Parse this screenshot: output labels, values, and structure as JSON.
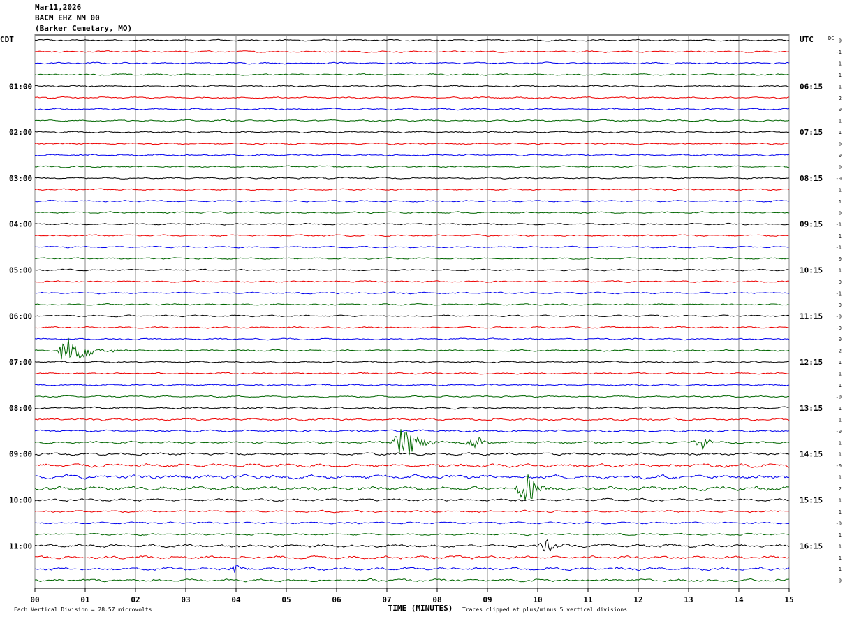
{
  "header": {
    "date": "Mar11,2026",
    "station": "BACM EHZ NM 00",
    "location": "(Barker Cemetary, MO)"
  },
  "colors": {
    "palette": [
      "#000000",
      "#ee0000",
      "#0000ee",
      "#006600"
    ],
    "grid": "#888888"
  },
  "chart_data": {
    "type": "line",
    "title": "Mar11,2026",
    "left_axis_title": "CDT",
    "right_axis_title": "UTC",
    "dc_title": "DC",
    "xlabel": "TIME (MINUTES)",
    "x_range": [
      0,
      15
    ],
    "x_ticks": [
      "00",
      "01",
      "02",
      "03",
      "04",
      "05",
      "06",
      "07",
      "08",
      "09",
      "10",
      "11",
      "12",
      "13",
      "14",
      "15"
    ],
    "trace_count": 48,
    "minutes_per_trace": 15,
    "left_time_labels": [
      {
        "trace": 4,
        "label": "01:00"
      },
      {
        "trace": 8,
        "label": "02:00"
      },
      {
        "trace": 12,
        "label": "03:00"
      },
      {
        "trace": 16,
        "label": "04:00"
      },
      {
        "trace": 20,
        "label": "05:00"
      },
      {
        "trace": 24,
        "label": "06:00"
      },
      {
        "trace": 28,
        "label": "07:00"
      },
      {
        "trace": 32,
        "label": "08:00"
      },
      {
        "trace": 36,
        "label": "09:00"
      },
      {
        "trace": 40,
        "label": "10:00"
      },
      {
        "trace": 44,
        "label": "11:00"
      }
    ],
    "right_time_labels": [
      {
        "trace": 4,
        "label": "06:15"
      },
      {
        "trace": 8,
        "label": "07:15"
      },
      {
        "trace": 12,
        "label": "08:15"
      },
      {
        "trace": 16,
        "label": "09:15"
      },
      {
        "trace": 20,
        "label": "10:15"
      },
      {
        "trace": 24,
        "label": "11:15"
      },
      {
        "trace": 28,
        "label": "12:15"
      },
      {
        "trace": 32,
        "label": "13:15"
      },
      {
        "trace": 36,
        "label": "14:15"
      },
      {
        "trace": 40,
        "label": "15:15"
      },
      {
        "trace": 44,
        "label": "16:15"
      }
    ],
    "dc_offsets": [
      "0",
      "-1",
      "-1",
      "1",
      "1",
      "2",
      "0",
      "1",
      "1",
      "0",
      "0",
      "0",
      "-0",
      "1",
      "1",
      "0",
      "-1",
      "1",
      "-1",
      "0",
      "1",
      "0",
      "-1",
      "0",
      "-0",
      "-0",
      "0",
      "-2",
      "1",
      "1",
      "1",
      "-0",
      "1",
      "1",
      "-0",
      "1",
      "1",
      "-0",
      "1",
      "2",
      "1",
      "1",
      "-0",
      "1",
      "1",
      "1",
      "1",
      "-0"
    ],
    "noise_levels": [
      1,
      1,
      1,
      1,
      1,
      1,
      1,
      1,
      1,
      1,
      1,
      1,
      1,
      1,
      1,
      1,
      1,
      1,
      1,
      1,
      1,
      1,
      1,
      1,
      1,
      1,
      1,
      1,
      1,
      1,
      1,
      1,
      1.2,
      1.3,
      1.3,
      1.4,
      1.5,
      2.2,
      2.5,
      2.4,
      1.6,
      1.3,
      1.2,
      1.2,
      1.8,
      1.8,
      1.8,
      1.6
    ],
    "events": [
      {
        "trace": 27,
        "minute": 0.6,
        "amplitude": 3.5,
        "duration": 1.4
      },
      {
        "trace": 35,
        "minute": 7.25,
        "amplitude": 5.0,
        "duration": 0.8
      },
      {
        "trace": 35,
        "minute": 8.65,
        "amplitude": 1.8,
        "duration": 0.5
      },
      {
        "trace": 35,
        "minute": 13.2,
        "amplitude": 2.0,
        "duration": 0.5
      },
      {
        "trace": 39,
        "minute": 9.7,
        "amplitude": 3.8,
        "duration": 0.8
      },
      {
        "trace": 44,
        "minute": 10.1,
        "amplitude": 2.0,
        "duration": 0.6
      },
      {
        "trace": 46,
        "minute": 3.9,
        "amplitude": 1.2,
        "duration": 0.4
      }
    ],
    "footer_left": "Each Vertical Division =   28.57 microvolts",
    "footer_right": "Traces clipped at plus/minus 5 vertical divisions"
  }
}
